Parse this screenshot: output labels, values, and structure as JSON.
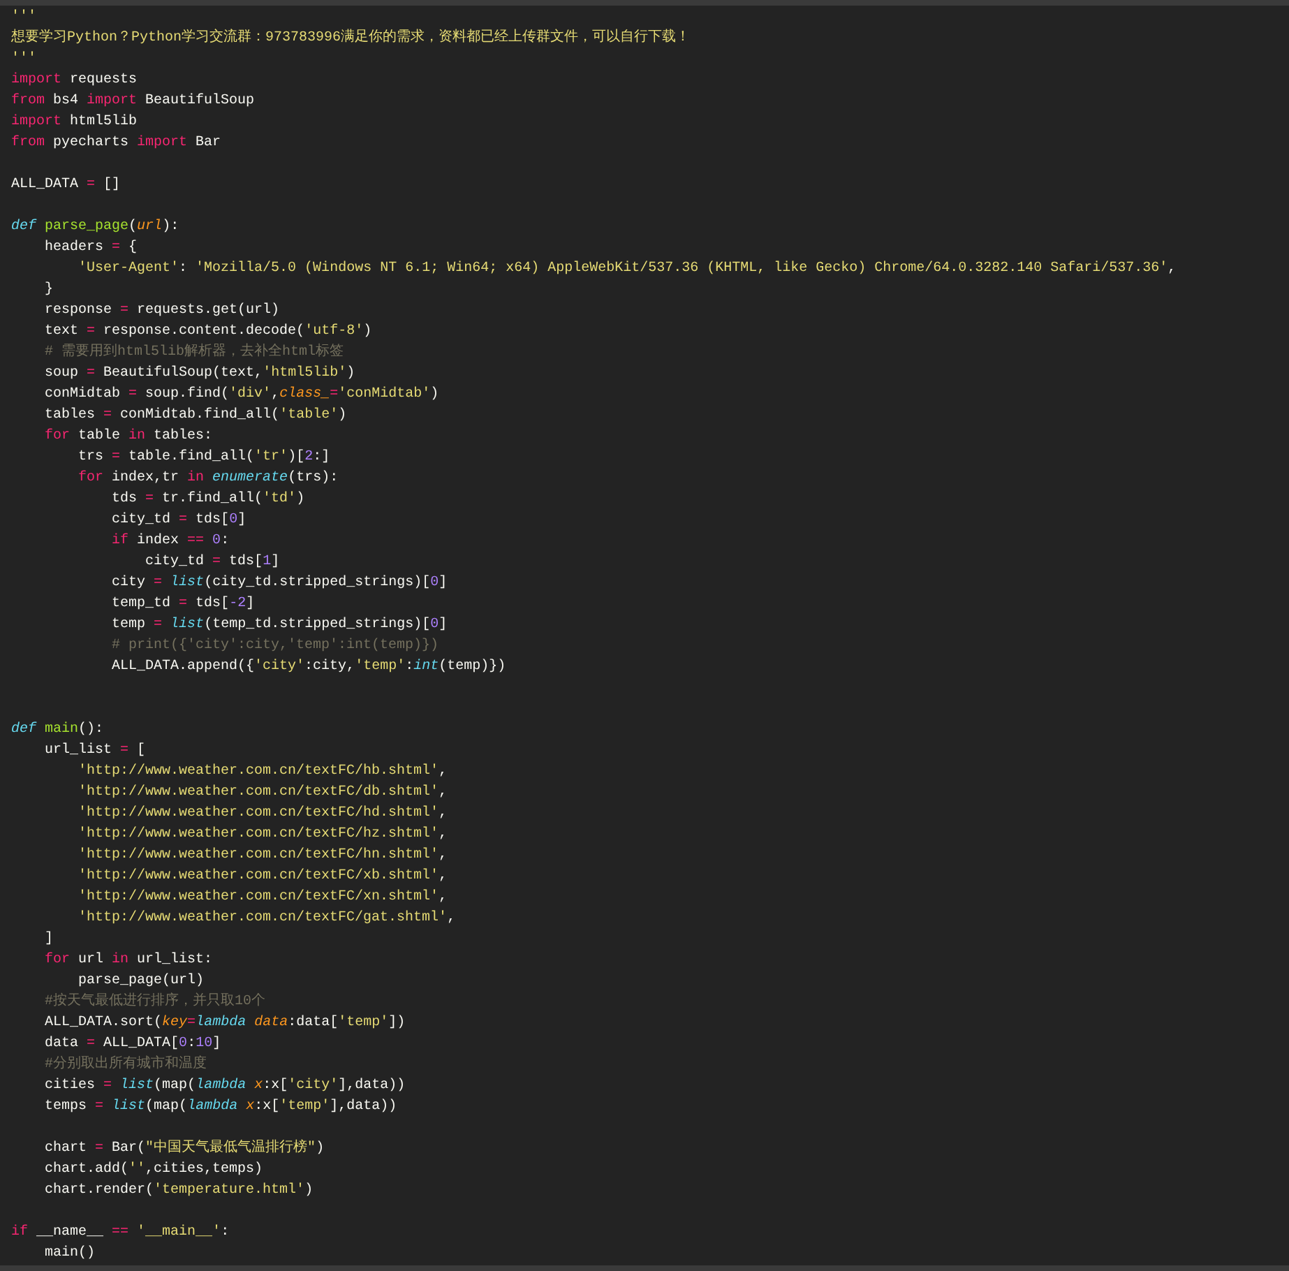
{
  "editor": {
    "lines": [
      {
        "kind": "code",
        "tokens": [
          {
            "kind": "str",
            "text": "'''"
          }
        ]
      },
      {
        "kind": "code",
        "tokens": [
          {
            "kind": "str",
            "text": "想要学习Python？Python学习交流群：973783996满足你的需求，资料都已经上传群文件，可以自行下载！"
          }
        ]
      },
      {
        "kind": "code",
        "tokens": [
          {
            "kind": "str",
            "text": "'''"
          }
        ]
      },
      {
        "kind": "code",
        "tokens": [
          {
            "kind": "kw",
            "text": "import"
          },
          {
            "kind": "plain",
            "text": " requests"
          }
        ]
      },
      {
        "kind": "code",
        "tokens": [
          {
            "kind": "kw",
            "text": "from"
          },
          {
            "kind": "plain",
            "text": " bs4 "
          },
          {
            "kind": "kw",
            "text": "import"
          },
          {
            "kind": "plain",
            "text": " BeautifulSoup"
          }
        ]
      },
      {
        "kind": "code",
        "tokens": [
          {
            "kind": "kw",
            "text": "import"
          },
          {
            "kind": "plain",
            "text": " html5lib"
          }
        ]
      },
      {
        "kind": "code",
        "tokens": [
          {
            "kind": "kw",
            "text": "from"
          },
          {
            "kind": "plain",
            "text": " pyecharts "
          },
          {
            "kind": "kw",
            "text": "import"
          },
          {
            "kind": "plain",
            "text": " Bar"
          }
        ]
      },
      {
        "kind": "blank"
      },
      {
        "kind": "code",
        "tokens": [
          {
            "kind": "plain",
            "text": "ALL_DATA "
          },
          {
            "kind": "op",
            "text": "="
          },
          {
            "kind": "plain",
            "text": " []"
          }
        ]
      },
      {
        "kind": "blank"
      },
      {
        "kind": "code",
        "tokens": [
          {
            "kind": "def",
            "text": "def"
          },
          {
            "kind": "fn",
            "text": " parse_page"
          },
          {
            "kind": "plain",
            "text": "("
          },
          {
            "kind": "param",
            "text": "url"
          },
          {
            "kind": "plain",
            "text": "):"
          }
        ]
      },
      {
        "kind": "code",
        "tokens": [
          {
            "kind": "plain",
            "text": "    headers "
          },
          {
            "kind": "op",
            "text": "="
          },
          {
            "kind": "plain",
            "text": " {"
          }
        ]
      },
      {
        "kind": "code",
        "tokens": [
          {
            "kind": "str",
            "text": "        'User-Agent'"
          },
          {
            "kind": "plain",
            "text": ": "
          },
          {
            "kind": "str",
            "text": "'Mozilla/5.0 (Windows NT 6.1; Win64; x64) AppleWebKit/537.36 (KHTML, like Gecko) Chrome/64.0.3282.140 Safari/537.36'"
          },
          {
            "kind": "plain",
            "text": ","
          }
        ]
      },
      {
        "kind": "code",
        "tokens": [
          {
            "kind": "plain",
            "text": "    }"
          }
        ]
      },
      {
        "kind": "code",
        "tokens": [
          {
            "kind": "plain",
            "text": "    response "
          },
          {
            "kind": "op",
            "text": "="
          },
          {
            "kind": "plain",
            "text": " requests.get(url)"
          }
        ]
      },
      {
        "kind": "code",
        "tokens": [
          {
            "kind": "plain",
            "text": "    text "
          },
          {
            "kind": "op",
            "text": "="
          },
          {
            "kind": "plain",
            "text": " response.content.decode("
          },
          {
            "kind": "str",
            "text": "'utf-8'"
          },
          {
            "kind": "plain",
            "text": ")"
          }
        ]
      },
      {
        "kind": "code",
        "tokens": [
          {
            "kind": "comment",
            "text": "    # 需要用到html5lib解析器，去补全html标签"
          }
        ]
      },
      {
        "kind": "code",
        "tokens": [
          {
            "kind": "plain",
            "text": "    soup "
          },
          {
            "kind": "op",
            "text": "="
          },
          {
            "kind": "plain",
            "text": " BeautifulSoup(text,"
          },
          {
            "kind": "str",
            "text": "'html5lib'"
          },
          {
            "kind": "plain",
            "text": ")"
          }
        ]
      },
      {
        "kind": "code",
        "tokens": [
          {
            "kind": "plain",
            "text": "    conMidtab "
          },
          {
            "kind": "op",
            "text": "="
          },
          {
            "kind": "plain",
            "text": " soup.find("
          },
          {
            "kind": "str",
            "text": "'div'"
          },
          {
            "kind": "plain",
            "text": ","
          },
          {
            "kind": "param",
            "text": "class_"
          },
          {
            "kind": "op",
            "text": "="
          },
          {
            "kind": "str",
            "text": "'conMidtab'"
          },
          {
            "kind": "plain",
            "text": ")"
          }
        ]
      },
      {
        "kind": "code",
        "tokens": [
          {
            "kind": "plain",
            "text": "    tables "
          },
          {
            "kind": "op",
            "text": "="
          },
          {
            "kind": "plain",
            "text": " conMidtab.find_all("
          },
          {
            "kind": "str",
            "text": "'table'"
          },
          {
            "kind": "plain",
            "text": ")"
          }
        ]
      },
      {
        "kind": "code",
        "tokens": [
          {
            "kind": "kw",
            "text": "    for"
          },
          {
            "kind": "plain",
            "text": " table "
          },
          {
            "kind": "kw",
            "text": "in"
          },
          {
            "kind": "plain",
            "text": " tables:"
          }
        ]
      },
      {
        "kind": "code",
        "tokens": [
          {
            "kind": "plain",
            "text": "        trs "
          },
          {
            "kind": "op",
            "text": "="
          },
          {
            "kind": "plain",
            "text": " table.find_all("
          },
          {
            "kind": "str",
            "text": "'tr'"
          },
          {
            "kind": "plain",
            "text": ")["
          },
          {
            "kind": "num",
            "text": "2"
          },
          {
            "kind": "plain",
            "text": ":]"
          }
        ]
      },
      {
        "kind": "code",
        "tokens": [
          {
            "kind": "kw",
            "text": "        for"
          },
          {
            "kind": "plain",
            "text": " index,tr "
          },
          {
            "kind": "kw",
            "text": "in"
          },
          {
            "kind": "builtin",
            "text": " enumerate"
          },
          {
            "kind": "plain",
            "text": "(trs):"
          }
        ]
      },
      {
        "kind": "code",
        "tokens": [
          {
            "kind": "plain",
            "text": "            tds "
          },
          {
            "kind": "op",
            "text": "="
          },
          {
            "kind": "plain",
            "text": " tr.find_all("
          },
          {
            "kind": "str",
            "text": "'td'"
          },
          {
            "kind": "plain",
            "text": ")"
          }
        ]
      },
      {
        "kind": "code",
        "tokens": [
          {
            "kind": "plain",
            "text": "            city_td "
          },
          {
            "kind": "op",
            "text": "="
          },
          {
            "kind": "plain",
            "text": " tds["
          },
          {
            "kind": "num",
            "text": "0"
          },
          {
            "kind": "plain",
            "text": "]"
          }
        ]
      },
      {
        "kind": "code",
        "tokens": [
          {
            "kind": "kw",
            "text": "            if"
          },
          {
            "kind": "plain",
            "text": " index "
          },
          {
            "kind": "op",
            "text": "=="
          },
          {
            "kind": "num",
            "text": " 0"
          },
          {
            "kind": "plain",
            "text": ":"
          }
        ]
      },
      {
        "kind": "code",
        "tokens": [
          {
            "kind": "plain",
            "text": "                city_td "
          },
          {
            "kind": "op",
            "text": "="
          },
          {
            "kind": "plain",
            "text": " tds["
          },
          {
            "kind": "num",
            "text": "1"
          },
          {
            "kind": "plain",
            "text": "]"
          }
        ]
      },
      {
        "kind": "code",
        "tokens": [
          {
            "kind": "plain",
            "text": "            city "
          },
          {
            "kind": "op",
            "text": "="
          },
          {
            "kind": "builtin",
            "text": " list"
          },
          {
            "kind": "plain",
            "text": "(city_td.stripped_strings)["
          },
          {
            "kind": "num",
            "text": "0"
          },
          {
            "kind": "plain",
            "text": "]"
          }
        ]
      },
      {
        "kind": "code",
        "tokens": [
          {
            "kind": "plain",
            "text": "            temp_td "
          },
          {
            "kind": "op",
            "text": "="
          },
          {
            "kind": "plain",
            "text": " tds["
          },
          {
            "kind": "num",
            "text": "-2"
          },
          {
            "kind": "plain",
            "text": "]"
          }
        ]
      },
      {
        "kind": "code",
        "tokens": [
          {
            "kind": "plain",
            "text": "            temp "
          },
          {
            "kind": "op",
            "text": "="
          },
          {
            "kind": "builtin",
            "text": " list"
          },
          {
            "kind": "plain",
            "text": "(temp_td.stripped_strings)["
          },
          {
            "kind": "num",
            "text": "0"
          },
          {
            "kind": "plain",
            "text": "]"
          }
        ]
      },
      {
        "kind": "code",
        "tokens": [
          {
            "kind": "comment",
            "text": "            # print({'city':city,'temp':int(temp)})"
          }
        ]
      },
      {
        "kind": "code",
        "tokens": [
          {
            "kind": "plain",
            "text": "            ALL_DATA.append({"
          },
          {
            "kind": "str",
            "text": "'city'"
          },
          {
            "kind": "plain",
            "text": ":city,"
          },
          {
            "kind": "str",
            "text": "'temp'"
          },
          {
            "kind": "plain",
            "text": ":"
          },
          {
            "kind": "builtin",
            "text": "int"
          },
          {
            "kind": "plain",
            "text": "(temp)})"
          }
        ]
      },
      {
        "kind": "blank"
      },
      {
        "kind": "blank"
      },
      {
        "kind": "code",
        "tokens": [
          {
            "kind": "def",
            "text": "def"
          },
          {
            "kind": "fn",
            "text": " main"
          },
          {
            "kind": "plain",
            "text": "():"
          }
        ]
      },
      {
        "kind": "code",
        "tokens": [
          {
            "kind": "plain",
            "text": "    url_list "
          },
          {
            "kind": "op",
            "text": "="
          },
          {
            "kind": "plain",
            "text": " ["
          }
        ]
      },
      {
        "kind": "code",
        "tokens": [
          {
            "kind": "str",
            "text": "        'http://www.weather.com.cn/textFC/hb.shtml'"
          },
          {
            "kind": "plain",
            "text": ","
          }
        ]
      },
      {
        "kind": "code",
        "tokens": [
          {
            "kind": "str",
            "text": "        'http://www.weather.com.cn/textFC/db.shtml'"
          },
          {
            "kind": "plain",
            "text": ","
          }
        ]
      },
      {
        "kind": "code",
        "tokens": [
          {
            "kind": "str",
            "text": "        'http://www.weather.com.cn/textFC/hd.shtml'"
          },
          {
            "kind": "plain",
            "text": ","
          }
        ]
      },
      {
        "kind": "code",
        "tokens": [
          {
            "kind": "str",
            "text": "        'http://www.weather.com.cn/textFC/hz.shtml'"
          },
          {
            "kind": "plain",
            "text": ","
          }
        ]
      },
      {
        "kind": "code",
        "tokens": [
          {
            "kind": "str",
            "text": "        'http://www.weather.com.cn/textFC/hn.shtml'"
          },
          {
            "kind": "plain",
            "text": ","
          }
        ]
      },
      {
        "kind": "code",
        "tokens": [
          {
            "kind": "str",
            "text": "        'http://www.weather.com.cn/textFC/xb.shtml'"
          },
          {
            "kind": "plain",
            "text": ","
          }
        ]
      },
      {
        "kind": "code",
        "tokens": [
          {
            "kind": "str",
            "text": "        'http://www.weather.com.cn/textFC/xn.shtml'"
          },
          {
            "kind": "plain",
            "text": ","
          }
        ]
      },
      {
        "kind": "code",
        "tokens": [
          {
            "kind": "str",
            "text": "        'http://www.weather.com.cn/textFC/gat.shtml'"
          },
          {
            "kind": "plain",
            "text": ","
          }
        ]
      },
      {
        "kind": "code",
        "tokens": [
          {
            "kind": "plain",
            "text": "    ]"
          }
        ]
      },
      {
        "kind": "code",
        "tokens": [
          {
            "kind": "kw",
            "text": "    for"
          },
          {
            "kind": "plain",
            "text": " url "
          },
          {
            "kind": "kw",
            "text": "in"
          },
          {
            "kind": "plain",
            "text": " url_list:"
          }
        ]
      },
      {
        "kind": "code",
        "tokens": [
          {
            "kind": "plain",
            "text": "        parse_page(url)"
          }
        ]
      },
      {
        "kind": "code",
        "tokens": [
          {
            "kind": "comment",
            "text": "    #按天气最低进行排序，并只取10个"
          }
        ]
      },
      {
        "kind": "code",
        "tokens": [
          {
            "kind": "plain",
            "text": "    ALL_DATA.sort("
          },
          {
            "kind": "param",
            "text": "key"
          },
          {
            "kind": "op",
            "text": "="
          },
          {
            "kind": "builtin",
            "text": "lambda"
          },
          {
            "kind": "param",
            "text": " data"
          },
          {
            "kind": "plain",
            "text": ":data["
          },
          {
            "kind": "str",
            "text": "'temp'"
          },
          {
            "kind": "plain",
            "text": "])"
          }
        ]
      },
      {
        "kind": "code",
        "tokens": [
          {
            "kind": "plain",
            "text": "    data "
          },
          {
            "kind": "op",
            "text": "="
          },
          {
            "kind": "plain",
            "text": " ALL_DATA["
          },
          {
            "kind": "num",
            "text": "0"
          },
          {
            "kind": "plain",
            "text": ":"
          },
          {
            "kind": "num",
            "text": "10"
          },
          {
            "kind": "plain",
            "text": "]"
          }
        ]
      },
      {
        "kind": "code",
        "tokens": [
          {
            "kind": "comment",
            "text": "    #分别取出所有城市和温度"
          }
        ]
      },
      {
        "kind": "code",
        "tokens": [
          {
            "kind": "plain",
            "text": "    cities "
          },
          {
            "kind": "op",
            "text": "="
          },
          {
            "kind": "builtin",
            "text": " list"
          },
          {
            "kind": "plain",
            "text": "(map("
          },
          {
            "kind": "builtin",
            "text": "lambda"
          },
          {
            "kind": "param",
            "text": " x"
          },
          {
            "kind": "plain",
            "text": ":x["
          },
          {
            "kind": "str",
            "text": "'city'"
          },
          {
            "kind": "plain",
            "text": "],data))"
          }
        ]
      },
      {
        "kind": "code",
        "tokens": [
          {
            "kind": "plain",
            "text": "    temps "
          },
          {
            "kind": "op",
            "text": "="
          },
          {
            "kind": "builtin",
            "text": " list"
          },
          {
            "kind": "plain",
            "text": "(map("
          },
          {
            "kind": "builtin",
            "text": "lambda"
          },
          {
            "kind": "param",
            "text": " x"
          },
          {
            "kind": "plain",
            "text": ":x["
          },
          {
            "kind": "str",
            "text": "'temp'"
          },
          {
            "kind": "plain",
            "text": "],data))"
          }
        ]
      },
      {
        "kind": "blank"
      },
      {
        "kind": "code",
        "tokens": [
          {
            "kind": "plain",
            "text": "    chart "
          },
          {
            "kind": "op",
            "text": "="
          },
          {
            "kind": "plain",
            "text": " Bar("
          },
          {
            "kind": "str",
            "text": "\"中国天气最低气温排行榜\""
          },
          {
            "kind": "plain",
            "text": ")"
          }
        ]
      },
      {
        "kind": "code",
        "tokens": [
          {
            "kind": "plain",
            "text": "    chart.add("
          },
          {
            "kind": "str",
            "text": "''"
          },
          {
            "kind": "plain",
            "text": ",cities,temps)"
          }
        ]
      },
      {
        "kind": "code",
        "tokens": [
          {
            "kind": "plain",
            "text": "    chart.render("
          },
          {
            "kind": "str",
            "text": "'temperature.html'"
          },
          {
            "kind": "plain",
            "text": ")"
          }
        ]
      },
      {
        "kind": "blank"
      },
      {
        "kind": "code",
        "tokens": [
          {
            "kind": "kw",
            "text": "if"
          },
          {
            "kind": "plain",
            "text": " __name__ "
          },
          {
            "kind": "op",
            "text": "=="
          },
          {
            "kind": "str",
            "text": " '__main__'"
          },
          {
            "kind": "plain",
            "text": ":"
          }
        ]
      },
      {
        "kind": "code",
        "tokens": [
          {
            "kind": "plain",
            "text": "    main()"
          }
        ]
      }
    ]
  }
}
